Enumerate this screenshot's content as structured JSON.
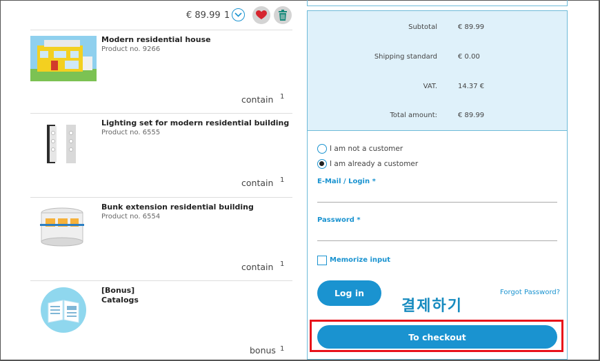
{
  "cart": {
    "top_price": "€ 89.99",
    "top_qty": "1",
    "items": [
      {
        "name": "Modern residential house",
        "product_no": "Product no. 9266",
        "qty_label": "contain",
        "qty": "1"
      },
      {
        "name": "Lighting set for modern residential building",
        "product_no": "Product no. 6555",
        "qty_label": "contain",
        "qty": "1"
      },
      {
        "name": "Bunk extension residential building",
        "product_no": "Product no. 6554",
        "qty_label": "contain",
        "qty": "1"
      },
      {
        "name_line1": "[Bonus]",
        "name_line2": "Catalogs",
        "qty_label": "bonus",
        "qty": "1"
      }
    ]
  },
  "summary": {
    "subtotal_label": "Subtotal",
    "subtotal_value": "€ 89.99",
    "shipping_label": "Shipping standard",
    "shipping_value": "€ 0.00",
    "vat_label": "VAT.",
    "vat_value": "14.37 €",
    "total_label": "Total amount:",
    "total_value": "€ 89.99"
  },
  "login": {
    "option_new": "I am not a customer",
    "option_existing": "I am already a customer",
    "email_label": "E-Mail / Login *",
    "password_label": "Password *",
    "memorize_label": "Memorize input",
    "login_button": "Log in",
    "forgot_link": "Forgot Password?"
  },
  "annotation": "결제하기",
  "checkout_button": "To checkout",
  "colors": {
    "accent": "#1a93d0",
    "summary_bg": "#dff1fa",
    "highlight": "#e8121a",
    "heart": "#d6252f"
  },
  "icons": [
    "chevron-down-icon",
    "heart-icon",
    "trash-icon",
    "catalog-icon"
  ]
}
